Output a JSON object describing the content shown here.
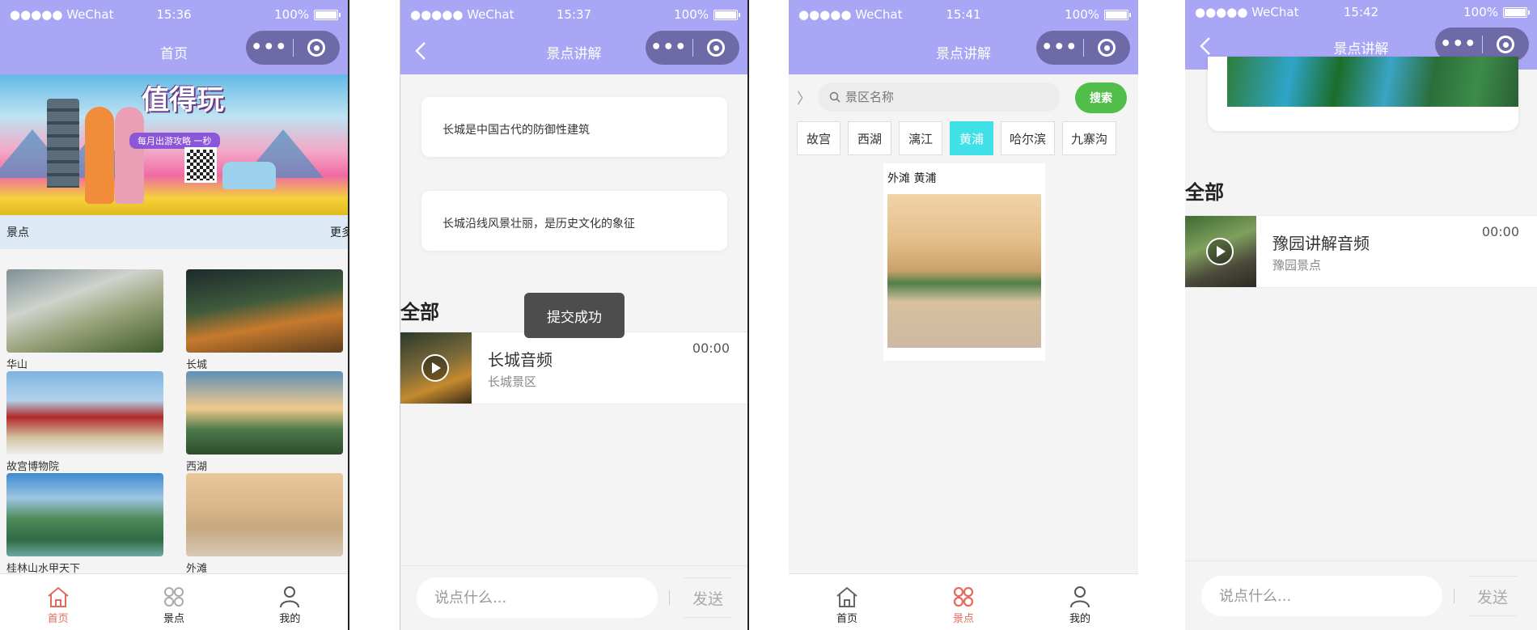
{
  "status": {
    "carrier": "●●●●● WeChat",
    "battery": "100%",
    "times": [
      "15:36",
      "15:37",
      "15:41",
      "15:42"
    ]
  },
  "screen1": {
    "nav_title": "首页",
    "banner_title": "值得玩",
    "banner_sub": "每月出游攻略 一秒",
    "section_label": "景点",
    "section_more": "更多",
    "spots": [
      "华山",
      "长城",
      "故宫博物院",
      "西湖",
      "桂林山水甲天下",
      "外滩"
    ]
  },
  "tabs": [
    "首页",
    "景点",
    "我的"
  ],
  "screen2": {
    "nav_title": "景点讲解",
    "comments": [
      "长城是中国古代的防御性建筑",
      "长城沿线风景壮丽，是历史文化的象征"
    ],
    "all_label": "全部",
    "toast": "提交成功",
    "audio": {
      "title": "长城音频",
      "subtitle": "长城景区",
      "time": "00:00"
    },
    "input_placeholder": "说点什么...",
    "send_label": "发送"
  },
  "screen3": {
    "nav_title": "景点讲解",
    "search_placeholder": "景区名称",
    "search_button": "搜索",
    "chips": [
      "故宫",
      "西湖",
      "漓江",
      "黄浦",
      "哈尔滨",
      "九寨沟"
    ],
    "active_chip": "黄浦",
    "card_label": "外滩 黄浦"
  },
  "screen4": {
    "nav_title": "景点讲解",
    "all_label": "全部",
    "audio": {
      "title": "豫园讲解音频",
      "subtitle": "豫园景点",
      "time": "00:00"
    },
    "input_placeholder": "说点什么...",
    "send_label": "发送"
  },
  "colors": {
    "header": "#a9a6f6",
    "capsule": "#6e6aa8",
    "tab_active": "#e46a5e",
    "chip_active": "#3fe0e8",
    "search_button": "#52be4a"
  }
}
